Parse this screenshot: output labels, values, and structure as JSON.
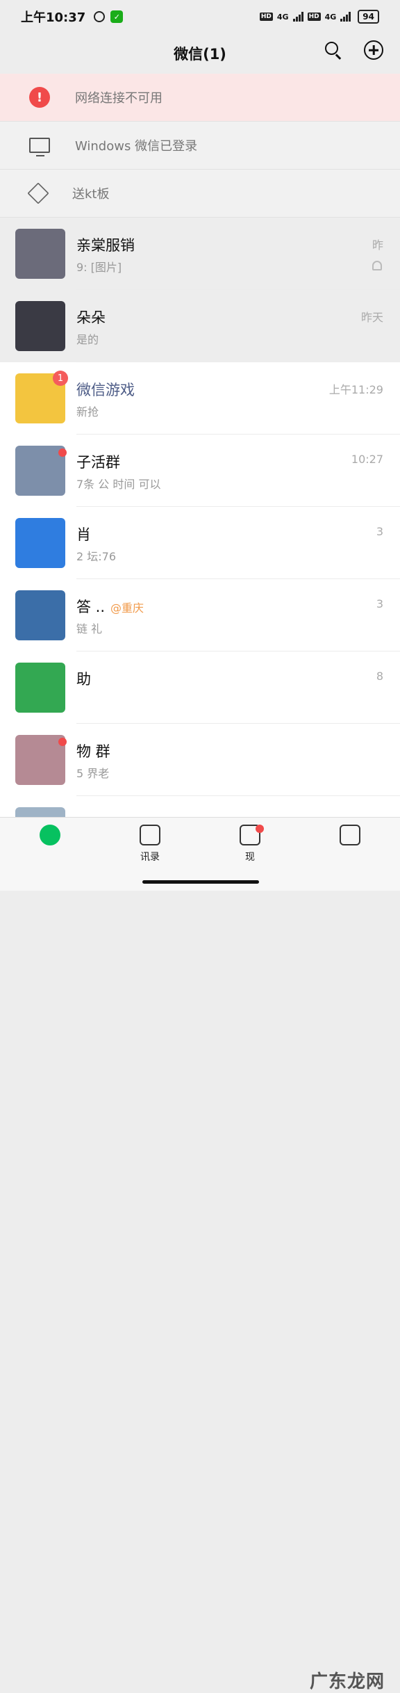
{
  "status_bar": {
    "time": "上午10:37",
    "network_1": "HD",
    "network_1_gen": "4G",
    "network_2": "HD",
    "network_2_gen": "4G",
    "battery": "94",
    "icons": [
      "alarm-icon",
      "shield-icon"
    ]
  },
  "header": {
    "title": "微信(1)",
    "actions": [
      "search-icon",
      "plus-icon"
    ]
  },
  "notices": {
    "network_error": "网络连接不可用",
    "pc_login": "Windows 微信已登录",
    "file_transfer": "送kt板"
  },
  "chats": [
    {
      "name": "亲棠服销",
      "preview": "9: [图片]",
      "time": "昨",
      "muted": true,
      "pinned": true,
      "avatar_color": "#6b6b7a"
    },
    {
      "name": "朵朵",
      "preview": "是的",
      "time": "昨天",
      "muted": false,
      "pinned": true,
      "avatar_color": "#3a3a44"
    },
    {
      "name": "微信游戏",
      "preview": "新抢",
      "time": "上午11:29",
      "badge": "1",
      "accent": true,
      "avatar_color": "#f3c53f"
    },
    {
      "name": "子活群",
      "preview": "7条 公 时间 可以",
      "time": "10:27",
      "dot": true,
      "avatar_color": "#7d8faa"
    },
    {
      "name": "肖",
      "preview": "2 坛:76",
      "time": "3",
      "avatar_color": "#2f7de0"
    },
    {
      "name": "答 ..",
      "preview": "链 礼",
      "time": "3",
      "tag": "@重庆",
      "avatar_color": "#3b6ea8"
    },
    {
      "name": "助",
      "preview": "",
      "time": "8",
      "avatar_color": "#33a852"
    },
    {
      "name": "物 群",
      "preview": "5 界老",
      "time": "",
      "dot": true,
      "avatar_color": "#b58a94"
    },
    {
      "name": "",
      "preview": "",
      "time": "",
      "avatar_color": "#9fb3c6"
    }
  ],
  "tabs": [
    {
      "label": "",
      "active": true
    },
    {
      "label": "讯录",
      "active": false
    },
    {
      "label": "现",
      "active": false,
      "dot": true
    },
    {
      "label": "",
      "active": false
    }
  ],
  "watermark": "广东龙网"
}
